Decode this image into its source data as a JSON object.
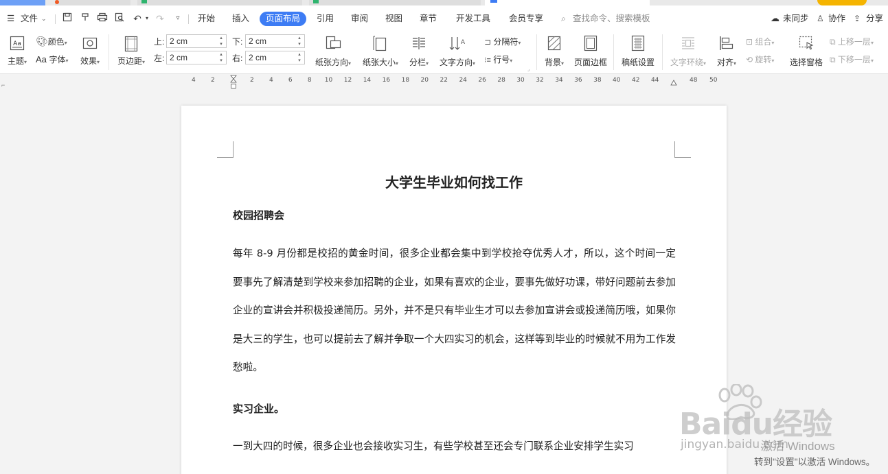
{
  "menu": {
    "file": "文件",
    "tabs": [
      "开始",
      "插入",
      "页面布局",
      "引用",
      "审阅",
      "视图",
      "章节",
      "开发工具",
      "会员专享"
    ],
    "active_tab": "页面布局",
    "search_placeholder": "查找命令、搜索模板",
    "sync": "未同步",
    "collab": "协作",
    "share": "分享"
  },
  "ribbon": {
    "theme": "主题",
    "color": "颜色",
    "font": "字体",
    "effect": "效果",
    "margin": "页边距",
    "top_label": "上:",
    "bottom_label": "下:",
    "left_label": "左:",
    "right_label": "右:",
    "top_value": "2 cm",
    "bottom_value": "2 cm",
    "left_value": "2 cm",
    "right_value": "2 cm",
    "orientation": "纸张方向",
    "size": "纸张大小",
    "columns": "分栏",
    "text_dir": "文字方向",
    "separator": "分隔符",
    "line_num": "行号",
    "background": "背景",
    "page_border": "页面边框",
    "draft": "稿纸设置",
    "wrap": "文字环绕",
    "align": "对齐",
    "group": "组合",
    "rotate": "旋转",
    "select_pane": "选择窗格",
    "bring_forward": "上移一层",
    "send_backward": "下移一层"
  },
  "ruler": {
    "left_numbers": [
      "4",
      "2"
    ],
    "numbers": [
      "2",
      "4",
      "6",
      "8",
      "10",
      "12",
      "14",
      "16",
      "18",
      "20",
      "22",
      "24",
      "26",
      "28",
      "30",
      "32",
      "34",
      "36",
      "38",
      "40",
      "42",
      "44"
    ],
    "right_numbers": [
      "48",
      "50"
    ]
  },
  "document": {
    "title": "大学生毕业如何找工作",
    "section1_heading": "校园招聘会",
    "section1_body": "每年 8-9 月份都是校招的黄金时间，很多企业都会集中到学校抢夺优秀人才，所以，这个时间一定要事先了解清楚到学校来参加招聘的企业，如果有喜欢的企业，要事先做好功课，带好问题前去参加企业的宣讲会并积极投递简历。另外，并不是只有毕业生才可以去参加宣讲会或投递简历哦，如果你是大三的学生，也可以提前去了解并争取一个大四实习的机会，这样等到毕业的时候就不用为工作发愁啦。",
    "section2_heading": "实习企业。",
    "section2_body": "一到大四的时候，很多企业也会接收实习生，有些学校甚至还会专门联系企业安排学生实习"
  },
  "watermark": {
    "brand": "Baidu经验",
    "url": "jingyan.baidu.com"
  },
  "activation": {
    "line1": "激活 Windows",
    "line2": "转到\"设置\"以激活 Windows。"
  },
  "colors": {
    "accent": "#3d7cf4",
    "page": "#ffffff",
    "workspace": "#f3f3f3"
  }
}
